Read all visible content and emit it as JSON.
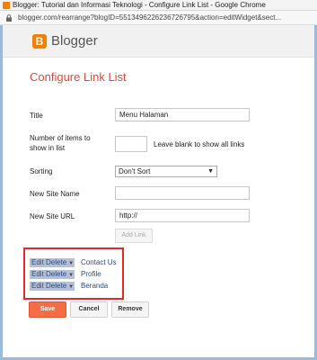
{
  "window": {
    "title": "Blogger: Tutorial dan Informasi Teknologi - Configure Link List - Google Chrome"
  },
  "address": {
    "url": "blogger.com/rearrange?blogID=5513496226236726795&action=editWidget&sect..."
  },
  "header": {
    "logo_letter": "B",
    "brand": "Blogger"
  },
  "page": {
    "title": "Configure Link List"
  },
  "form": {
    "title_label": "Title",
    "title_value": "Menu Halaman",
    "items_label_line1": "Number of items to",
    "items_label_line2": "show in list",
    "items_value": "",
    "items_hint": "Leave blank to show all links",
    "sorting_label": "Sorting",
    "sorting_value": "Don't Sort",
    "new_site_name_label": "New Site Name",
    "new_site_name_value": "",
    "new_site_url_label": "New Site URL",
    "new_site_url_value": "http://",
    "add_link_label": "Add Link"
  },
  "links": [
    {
      "edit": "Edit",
      "delete": "Delete",
      "name": "Contact Us"
    },
    {
      "edit": "Edit",
      "delete": "Delete",
      "name": "Profile"
    },
    {
      "edit": "Edit",
      "delete": "Delete",
      "name": "Beranda"
    }
  ],
  "actions": {
    "save": "Save",
    "cancel": "Cancel",
    "remove": "Remove"
  },
  "colors": {
    "accent": "#dd4b39",
    "save_button": "#f46d45",
    "highlight_box": "#e02b2b",
    "link": "#2b4a85",
    "chip": "#b3c0d6"
  },
  "icons": {
    "favicon": "blogger-favicon-icon",
    "lock": "lock-icon",
    "logo": "blogger-logo-icon",
    "caret": "caret-down-icon"
  }
}
